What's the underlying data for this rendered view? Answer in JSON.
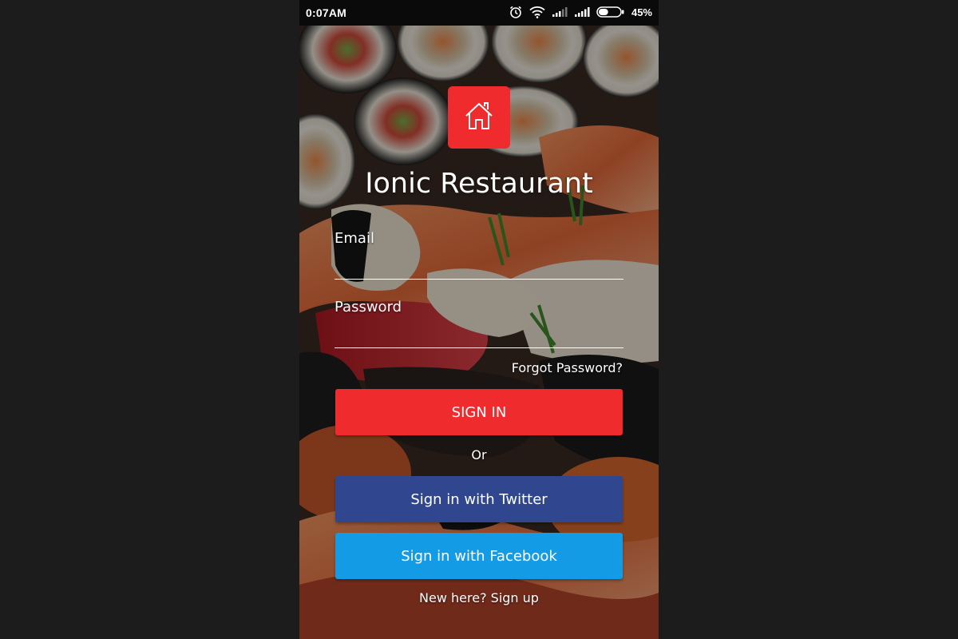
{
  "status_bar": {
    "time": "0:07AM",
    "battery_percent": "45%",
    "battery_level": 0.45,
    "icons": [
      "alarm-icon",
      "wifi-icon",
      "signal-icon",
      "signal-icon",
      "battery-icon"
    ]
  },
  "app": {
    "logo_icon": "home-icon",
    "title": "Ionic Restaurant"
  },
  "form": {
    "email_label": "Email",
    "email_value": "",
    "password_label": "Password",
    "password_value": "",
    "forgot_label": "Forgot Password?",
    "signin_label": "SIGN IN",
    "or_label": "Or",
    "twitter_label": "Sign in with Twitter",
    "facebook_label": "Sign in with Facebook",
    "signup_label": "New here? Sign up"
  },
  "colors": {
    "accent": "#ef2b2d",
    "twitter": "#30478f",
    "facebook": "#139be6",
    "page_background": "#1c1c1c"
  }
}
